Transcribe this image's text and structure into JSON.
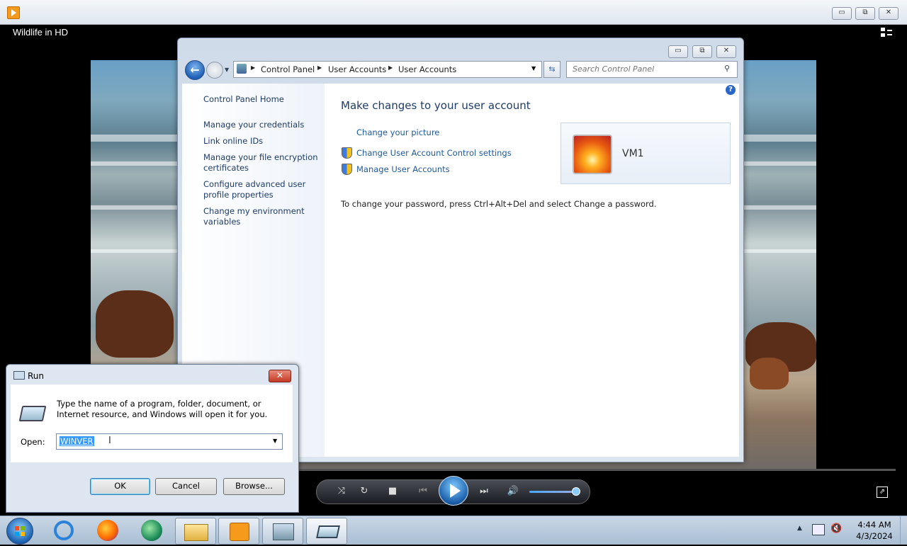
{
  "media_player": {
    "title": "Wildlife in HD",
    "caption_buttons": {
      "minimize": "▭",
      "restore": "⧉",
      "close": "✕"
    }
  },
  "control_panel": {
    "breadcrumbs": [
      "Control Panel",
      "User Accounts",
      "User Accounts"
    ],
    "search_placeholder": "Search Control Panel",
    "help_label": "?",
    "left_tasks": [
      "Control Panel Home",
      "Manage your credentials",
      "Link online IDs",
      "Manage your file encryption certificates",
      "Configure advanced user profile properties",
      "Change my environment variables"
    ],
    "heading": "Make changes to your user account",
    "links": {
      "change_picture": "Change your picture",
      "uac_settings": "Change User Account Control settings",
      "manage_accounts": "Manage User Accounts"
    },
    "user_name": "VM1",
    "password_note": "To change your password, press Ctrl+Alt+Del and select Change a password."
  },
  "run_dialog": {
    "title": "Run",
    "description": "Type the name of a program, folder, document, or Internet resource, and Windows will open it for you.",
    "open_label": "Open:",
    "open_value": "WINVER",
    "ok_label": "OK",
    "cancel_label": "Cancel",
    "browse_label": "Browse..."
  },
  "taskbar": {
    "time": "4:44 AM",
    "date": "4/3/2024"
  }
}
